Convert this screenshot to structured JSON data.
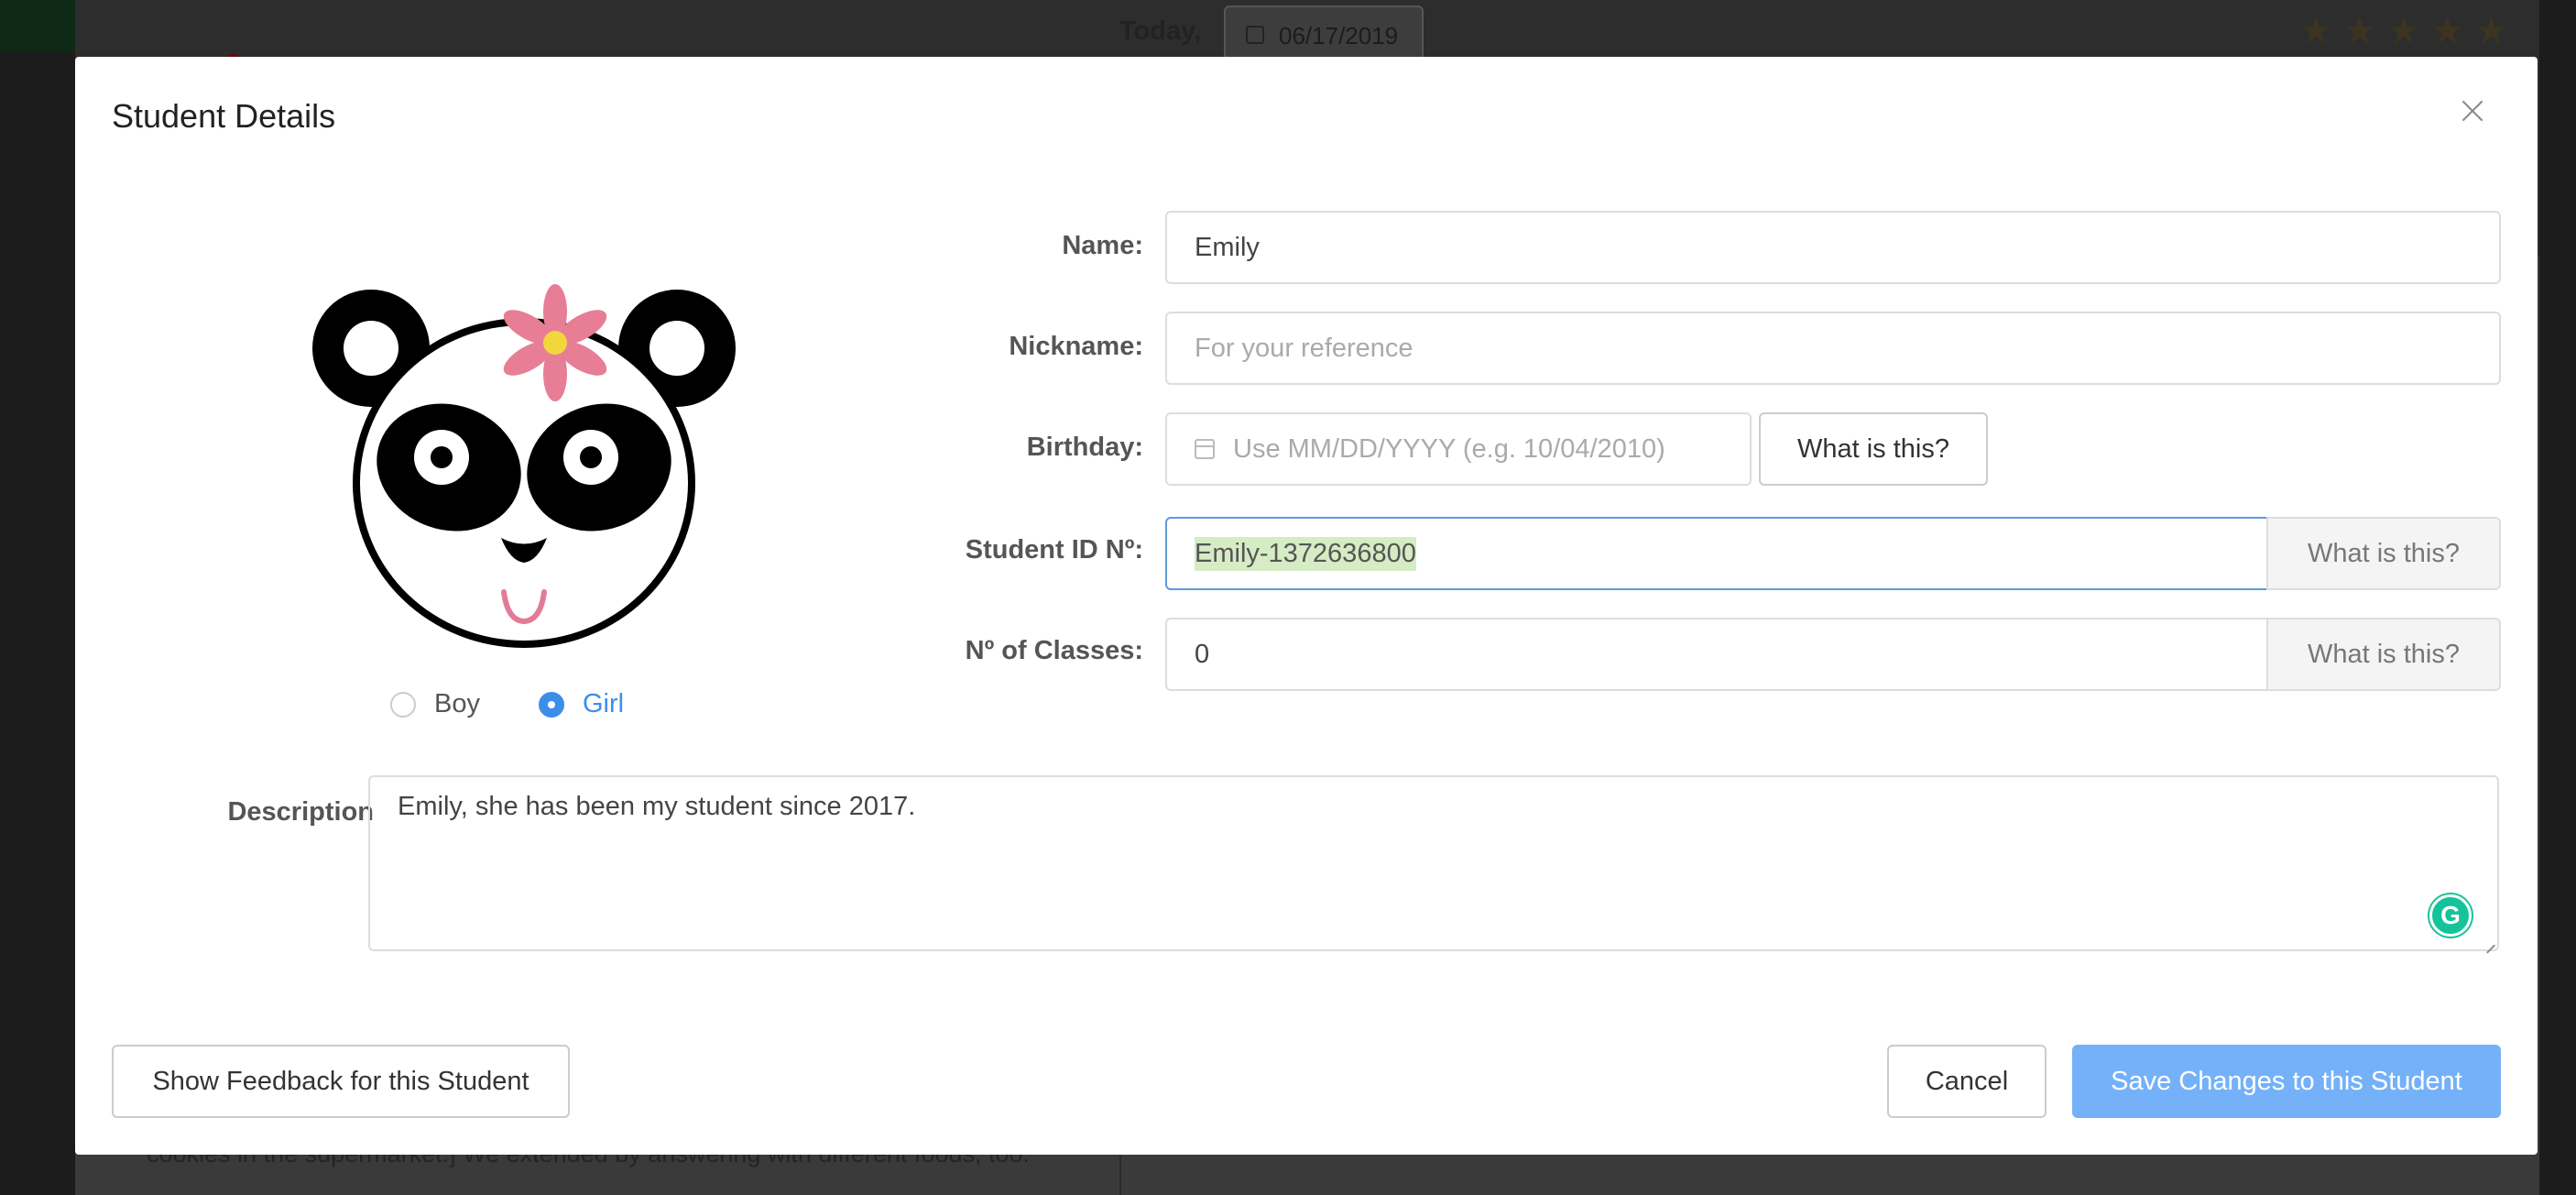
{
  "background": {
    "today_label": "Today,",
    "date_value": "06/17/2019",
    "star_count": 5,
    "bottom_text": "cookies in the supermarket.] We extended by answering with different foods, too."
  },
  "modal": {
    "title": "Student Details",
    "gender": {
      "boy_label": "Boy",
      "girl_label": "Girl",
      "selected": "Girl"
    },
    "fields": {
      "name": {
        "label": "Name:",
        "value": "Emily"
      },
      "nickname": {
        "label": "Nickname:",
        "placeholder": "For your reference"
      },
      "birthday": {
        "label": "Birthday:",
        "placeholder": "Use MM/DD/YYYY (e.g. 10/04/2010)",
        "help_button": "What is this?"
      },
      "student_id": {
        "label": "Student ID Nº:",
        "value": "Emily-1372636800",
        "help_button": "What is this?"
      },
      "num_classes": {
        "label": "Nº of Classes:",
        "value": "0",
        "help_button": "What is this?"
      }
    },
    "description": {
      "label": "Description",
      "value": "Emily, she has been my student since 2017."
    },
    "footer": {
      "feedback_button": "Show Feedback for this Student",
      "cancel_button": "Cancel",
      "save_button": "Save Changes to this Student"
    }
  },
  "colors": {
    "accent": "#3d8ee8",
    "primary_button": "#74b1f8",
    "focus_border": "#5b9bdc",
    "selection_highlight": "#d6ecc4",
    "grammarly": "#15c39a"
  },
  "icons": [
    "calendar-icon",
    "close-icon",
    "star-icon",
    "panda-avatar",
    "grammarly-icon"
  ]
}
